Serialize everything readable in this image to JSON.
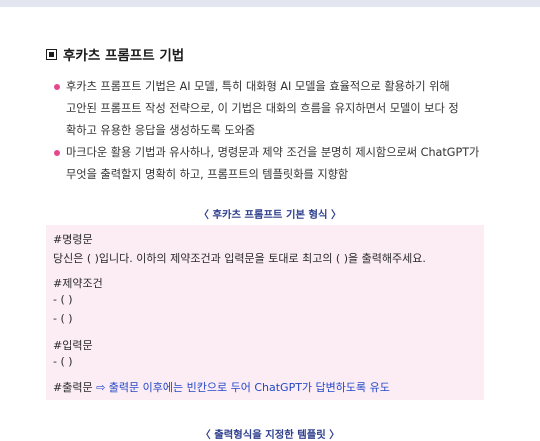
{
  "section": {
    "title": "후카츠 프롬프트 기법",
    "icon": "square-bullet-icon"
  },
  "bullets": [
    {
      "lines": [
        "후카츠 프롬프트 기법은 AI 모델, 특히 대화형 AI 모델을 효율적으로 활용하기 위해",
        "고안된 프롬프트 작성 전략으로, 이 기법은 대화의 흐름을 유지하면서 모델이 보다 정",
        "확하고 유용한 응답을 생성하도록 도와줌"
      ]
    },
    {
      "lines": [
        "마크다운 활용 기법과 유사하나, 명령문과 제약 조건을 분명히 제시함으로써 ChatGPT가",
        "무엇을 출력할지 명확히 하고, 프롬프트의 템플릿화를 지향함"
      ]
    }
  ],
  "caption1": "〈 후카츠 프롬프트 기본 형식 〉",
  "template": {
    "command_header": "#명령문",
    "command_line": "당신은 (        )입니다. 이하의 제약조건과 입력문을 토대로 최고의 (        )을 출력해주세요.",
    "constraints_header": "#제약조건",
    "constraint_1": "- (              )",
    "constraint_2": "- (              )",
    "input_header": "#입력문",
    "input_1": "- (              )",
    "output_header": "#출력문",
    "output_note": "⇨ 출력문 이후에는 빈칸으로 두어 ChatGPT가 답변하도록 유도"
  },
  "caption2": "〈 출력형식을 지정한 템플릿 〉",
  "colors": {
    "bullet": "#e3488e",
    "caption": "#2e3f8e",
    "box_bg": "#fcedf4",
    "note": "#2347c8"
  }
}
